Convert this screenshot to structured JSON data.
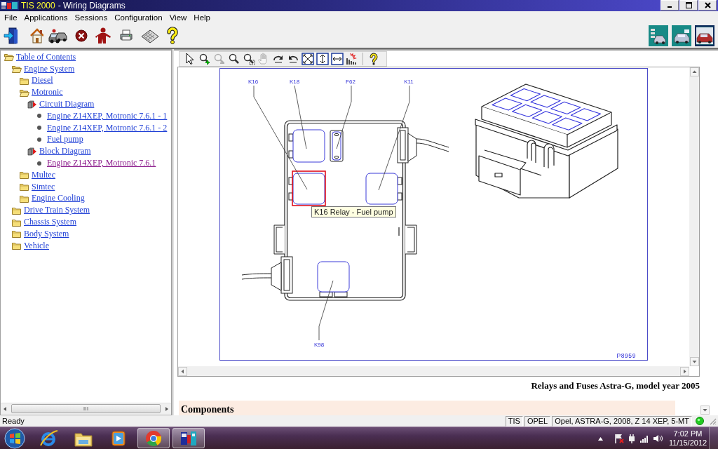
{
  "window": {
    "app_name": "TIS 2000",
    "title": "- Wiring Diagrams"
  },
  "menu": [
    "File",
    "Applications",
    "Sessions",
    "Configuration",
    "View",
    "Help"
  ],
  "app_tiles": [
    {
      "selected": false
    },
    {
      "selected": false
    },
    {
      "selected": true
    }
  ],
  "tree": [
    {
      "label": "Table of Contents",
      "kind": "folder",
      "expanded": true,
      "visited": false,
      "children": [
        {
          "label": "Engine System",
          "kind": "folder",
          "expanded": true,
          "visited": false,
          "children": [
            {
              "label": "Diesel",
              "kind": "folder",
              "expanded": false,
              "visited": false
            },
            {
              "label": "Motronic",
              "kind": "folder",
              "expanded": true,
              "visited": false,
              "children": [
                {
                  "label": "Circuit Diagram",
                  "kind": "diagram",
                  "visited": false,
                  "children": [
                    {
                      "label": "Engine Z14XEP, Motronic 7.6.1 - 1",
                      "kind": "page",
                      "visited": false
                    },
                    {
                      "label": "Engine Z14XEP, Motronic 7.6.1 - 2",
                      "kind": "page",
                      "visited": false
                    },
                    {
                      "label": "Fuel pump",
                      "kind": "page",
                      "visited": false
                    }
                  ]
                },
                {
                  "label": "Block Diagram",
                  "kind": "diagram",
                  "visited": false,
                  "children": [
                    {
                      "label": "Engine Z14XEP, Motronic 7.6.1",
                      "kind": "page",
                      "visited": true
                    }
                  ]
                }
              ]
            },
            {
              "label": "Multec",
              "kind": "folder",
              "expanded": false,
              "visited": false
            },
            {
              "label": "Simtec",
              "kind": "folder",
              "expanded": false,
              "visited": false
            },
            {
              "label": "Engine Cooling",
              "kind": "folder",
              "expanded": false,
              "visited": false
            }
          ]
        },
        {
          "label": "Drive Train System",
          "kind": "folder",
          "expanded": false,
          "visited": false
        },
        {
          "label": "Chassis System",
          "kind": "folder",
          "expanded": false,
          "visited": false
        },
        {
          "label": "Body System",
          "kind": "folder",
          "expanded": false,
          "visited": false
        },
        {
          "label": "Vehicle",
          "kind": "folder",
          "expanded": false,
          "visited": false
        }
      ]
    }
  ],
  "viewer": {
    "tools": [
      {
        "disabled": false
      },
      {
        "disabled": false
      },
      {
        "disabled": true
      },
      {
        "disabled": false
      },
      {
        "disabled": false
      },
      {
        "disabled": true
      },
      {
        "disabled": false
      },
      {
        "disabled": false
      },
      {
        "disabled": false
      },
      {
        "disabled": false
      },
      {
        "disabled": false
      },
      {
        "disabled": false
      },
      {
        "disabled": false
      }
    ],
    "callouts": [
      {
        "label": "K16",
        "highlighted": true
      },
      {
        "label": "K18",
        "highlighted": false
      },
      {
        "label": "F62",
        "highlighted": false
      },
      {
        "label": "K11",
        "highlighted": false
      },
      {
        "label": "K98",
        "highlighted": false
      }
    ],
    "tooltip": "K16 Relay - Fuel pump",
    "figure_number": "P8959"
  },
  "document": {
    "heading": "Relays and Fuses Astra-G, model year 2005",
    "section": "Components"
  },
  "status_bar": {
    "message": "Ready",
    "panels": [
      "TIS",
      "OPEL",
      "Opel, ASTRA-G, 2008, Z 14 XEP, 5-MT"
    ]
  },
  "taskbar": {
    "apps": [
      {
        "running": false
      },
      {
        "running": false
      },
      {
        "running": false
      },
      {
        "running": true
      },
      {
        "running": true
      }
    ],
    "time": "7:02 PM",
    "date": "11/15/2012"
  }
}
